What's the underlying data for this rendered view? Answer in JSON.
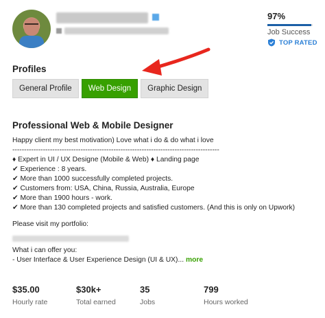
{
  "profile": {
    "job_success": {
      "percent_text": "97%",
      "fill_fraction": 0.97,
      "label": "Job Success"
    },
    "badge": {
      "label": "TOP RATED",
      "icon": "shield-icon",
      "color": "#2a7fd6"
    }
  },
  "profiles_section": {
    "label": "Profiles",
    "tabs": [
      {
        "label": "General Profile",
        "active": false
      },
      {
        "label": "Web Design",
        "active": true
      },
      {
        "label": "Graphic Design",
        "active": false
      }
    ]
  },
  "annotation": {
    "icon": "red-arrow-icon",
    "color": "#e8271e"
  },
  "overview": {
    "title": "Professional Web & Mobile Designer",
    "lines": [
      "Happy client my best motivation) Love what i do & do what i love",
      "----------------------------------------------------------------------------------------",
      "♦ Expert in UI / UX Designe (Mobile & Web) ♦ Landing page",
      "✔ Experience : 8 years.",
      "✔ More than 1000 successfully completed projects.",
      "✔ Customers from: USA, China, Russia, Australia, Europe",
      "✔ More than 1900 hours - work.",
      "✔ More than 130 completed projects and satisfied customers. (And this is only on Upwork)"
    ],
    "portfolio_label": "Please visit my portfolio:",
    "offer_label": "What i can offer you:",
    "offer_line": "- User Interface & User Experience Design (UI & UX)...",
    "more_link": "more"
  },
  "stats": [
    {
      "value": "$35.00",
      "label": "Hourly rate"
    },
    {
      "value": "$30k+",
      "label": "Total earned"
    },
    {
      "value": "35",
      "label": "Jobs"
    },
    {
      "value": "799",
      "label": "Hours worked"
    }
  ],
  "colors": {
    "accent_green": "#37a000",
    "job_success_bar": "#1b5fa6"
  }
}
